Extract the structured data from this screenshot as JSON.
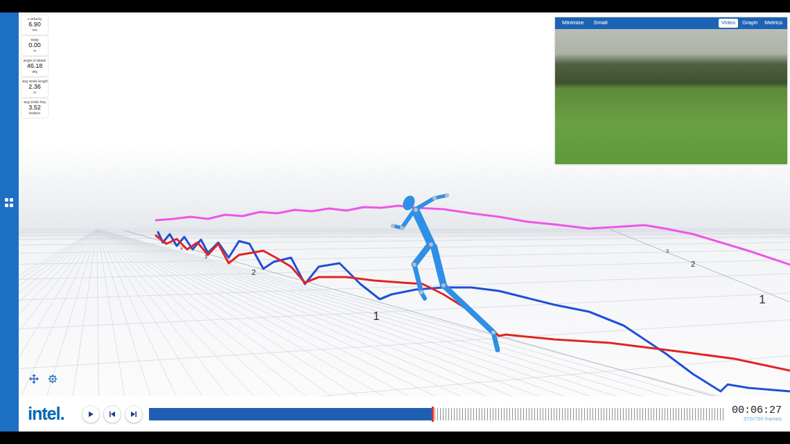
{
  "metrics": [
    {
      "label": "x velocity",
      "value": "6.90",
      "unit": "m/s"
    },
    {
      "label": "sway",
      "value": "0.00",
      "unit": "m"
    },
    {
      "label": "angle of attack",
      "value": "46.18",
      "unit": "deg"
    },
    {
      "label": "avg stride length",
      "value": "2.36",
      "unit": "m"
    },
    {
      "label": "avg stride freq",
      "value": "3.52",
      "unit": "strides/s"
    }
  ],
  "video_panel": {
    "buttons": [
      "Minimize",
      "Small"
    ],
    "tabs": [
      {
        "label": "Video",
        "selected": true
      },
      {
        "label": "Graph",
        "selected": false
      },
      {
        "label": "Metrics",
        "selected": false
      }
    ]
  },
  "chart": {
    "series": [
      {
        "color": "#ee55e8",
        "x": [
          225,
          250,
          275,
          300,
          325,
          350,
          375,
          400,
          425,
          450,
          475,
          500,
          525,
          550,
          575,
          600,
          640,
          680,
          720,
          760,
          800,
          850,
          900,
          930,
          960,
          1000,
          1040,
          1080,
          1140
        ],
        "y": [
          318,
          316,
          313,
          316,
          310,
          312,
          306,
          308,
          303,
          305,
          301,
          304,
          299,
          300,
          297,
          300,
          302,
          308,
          313,
          320,
          324,
          330,
          327,
          325,
          330,
          338,
          350,
          362,
          382
        ]
      },
      {
        "color": "#1f4fd8",
        "x": [
          228,
          235,
          245,
          255,
          266,
          278,
          290,
          300,
          315,
          330,
          345,
          360,
          380,
          395,
          420,
          440,
          460,
          490,
          520,
          548,
          565,
          600,
          640,
          680,
          720,
          760,
          800,
          850,
          900,
          960,
          1000,
          1040,
          1050,
          1080,
          1140
        ],
        "y": [
          335,
          350,
          338,
          355,
          342,
          360,
          346,
          365,
          350,
          372,
          348,
          352,
          388,
          378,
          372,
          410,
          385,
          380,
          410,
          432,
          425,
          418,
          415,
          415,
          420,
          430,
          440,
          450,
          470,
          510,
          540,
          565,
          555,
          560,
          565
        ]
      },
      {
        "color": "#e02424",
        "x": [
          225,
          240,
          255,
          270,
          285,
          300,
          315,
          330,
          345,
          380,
          400,
          420,
          440,
          460,
          500,
          540,
          580,
          610,
          640,
          680,
          720,
          730,
          800,
          880,
          960,
          1000,
          1060,
          1140
        ],
        "y": [
          340,
          352,
          345,
          360,
          350,
          368,
          352,
          380,
          368,
          362,
          373,
          385,
          408,
          400,
          400,
          405,
          408,
          410,
          425,
          450,
          485,
          483,
          490,
          495,
          505,
          510,
          518,
          535
        ]
      }
    ],
    "ticks_left": [
      "1",
      "2",
      "3",
      "4"
    ],
    "ticks_right": [
      "1",
      "2",
      "3"
    ]
  },
  "playback": {
    "logo": "intel.",
    "playing": false,
    "progress": {
      "level": 0.493
    },
    "time": "00:06:27",
    "frames": "370/750 frames"
  }
}
